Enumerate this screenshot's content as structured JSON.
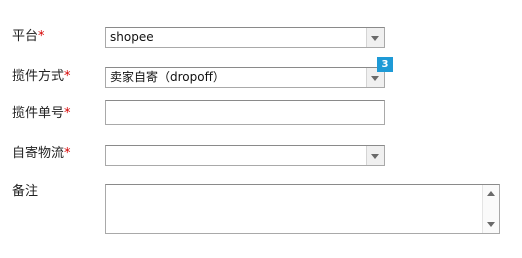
{
  "form": {
    "platform": {
      "label": "平台",
      "required_mark": "*",
      "value": "shopee"
    },
    "pickup_method": {
      "label": "揽件方式",
      "required_mark": "*",
      "value": "卖家自寄（dropoff）",
      "badge": "3"
    },
    "pickup_number": {
      "label": "揽件单号",
      "required_mark": "*",
      "value": ""
    },
    "self_ship_logistics": {
      "label": "自寄物流",
      "required_mark": "*",
      "value": ""
    },
    "remarks": {
      "label": "备注",
      "value": ""
    }
  },
  "colors": {
    "required": "#d60000",
    "badge": "#1e9ad6"
  },
  "icons": [
    "chevron-down-icon",
    "scroll-up-icon",
    "scroll-down-icon"
  ]
}
